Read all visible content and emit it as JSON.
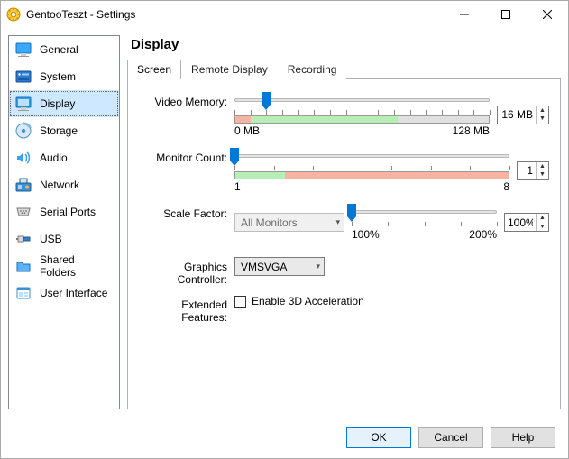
{
  "window": {
    "title": "GentooTeszt - Settings"
  },
  "sidebar": [
    {
      "label": "General"
    },
    {
      "label": "System"
    },
    {
      "label": "Display"
    },
    {
      "label": "Storage"
    },
    {
      "label": "Audio"
    },
    {
      "label": "Network"
    },
    {
      "label": "Serial Ports"
    },
    {
      "label": "USB"
    },
    {
      "label": "Shared Folders"
    },
    {
      "label": "User Interface"
    }
  ],
  "page": {
    "title": "Display",
    "tabs": [
      {
        "label": "Screen",
        "active": true
      },
      {
        "label": "Remote Display",
        "active": false
      },
      {
        "label": "Recording",
        "active": false
      }
    ]
  },
  "screen": {
    "video_memory": {
      "label": "Video Memory:",
      "value": 16,
      "value_display": "16 MB",
      "min": 0,
      "max": 128,
      "min_label": "0 MB",
      "max_label": "128 MB",
      "ticks": 17
    },
    "monitor_count": {
      "label": "Monitor Count:",
      "value": 1,
      "value_display": "1",
      "min": 1,
      "max": 8,
      "min_label": "1",
      "max_label": "8",
      "ticks": 8
    },
    "scale_factor": {
      "label": "Scale Factor:",
      "monitor_select": "All Monitors",
      "value": 100,
      "value_display": "100%",
      "min": 100,
      "max": 200,
      "min_label": "100%",
      "max_label": "200%",
      "ticks": 5
    },
    "graphics_controller": {
      "label": "Graphics Controller:",
      "value": "VMSVGA"
    },
    "extended_features": {
      "label": "Extended Features:",
      "enable_3d_label": "Enable 3D Acceleration",
      "enable_3d_checked": false
    }
  },
  "footer": {
    "ok": "OK",
    "cancel": "Cancel",
    "help": "Help"
  }
}
